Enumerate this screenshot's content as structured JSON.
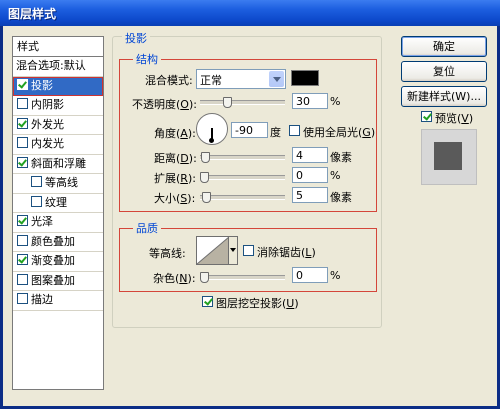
{
  "window": {
    "title": "图层样式"
  },
  "style_list": {
    "header": "样式",
    "blend_options": "混合选项:默认",
    "items": [
      {
        "label": "投影",
        "checked": true,
        "selected": true,
        "indent": false
      },
      {
        "label": "内阴影",
        "checked": false,
        "indent": false
      },
      {
        "label": "外发光",
        "checked": true,
        "indent": false
      },
      {
        "label": "内发光",
        "checked": false,
        "indent": false
      },
      {
        "label": "斜面和浮雕",
        "checked": true,
        "indent": false
      },
      {
        "label": "等高线",
        "checked": false,
        "indent": true
      },
      {
        "label": "纹理",
        "checked": false,
        "indent": true
      },
      {
        "label": "光泽",
        "checked": true,
        "indent": false
      },
      {
        "label": "颜色叠加",
        "checked": false,
        "indent": false
      },
      {
        "label": "渐变叠加",
        "checked": true,
        "indent": false
      },
      {
        "label": "图案叠加",
        "checked": false,
        "indent": false
      },
      {
        "label": "描边",
        "checked": false,
        "indent": false
      }
    ]
  },
  "drop_shadow": {
    "group_title": "投影",
    "structure": {
      "title": "结构",
      "blend_mode_label": "混合模式:",
      "blend_mode_value": "正常",
      "shadow_color": "#000000",
      "opacity_label_pre": "不透明度(",
      "opacity_key": "O",
      "opacity_label_post": "):",
      "opacity_value": "30",
      "opacity_unit": "%",
      "angle_label_pre": "角度(",
      "angle_key": "A",
      "angle_label_post": "):",
      "angle_value": "-90",
      "angle_unit": "度",
      "global_light_pre": "使用全局光(",
      "global_light_key": "G",
      "global_light_post": ")",
      "global_light_checked": false,
      "distance_label_pre": "距离(",
      "distance_key": "D",
      "distance_label_post": "):",
      "distance_value": "4",
      "distance_unit": "像素",
      "spread_label_pre": "扩展(",
      "spread_key": "R",
      "spread_label_post": "):",
      "spread_value": "0",
      "spread_unit": "%",
      "size_label_pre": "大小(",
      "size_key": "S",
      "size_label_post": "):",
      "size_value": "5",
      "size_unit": "像素"
    },
    "quality": {
      "title": "品质",
      "contour_label": "等高线:",
      "anti_alias_pre": "消除锯齿(",
      "anti_alias_key": "L",
      "anti_alias_post": ")",
      "anti_alias_checked": false,
      "noise_label_pre": "杂色(",
      "noise_key": "N",
      "noise_label_post": "):",
      "noise_value": "0",
      "noise_unit": "%"
    },
    "knockout_pre": "图层挖空投影(",
    "knockout_key": "U",
    "knockout_post": ")",
    "knockout_checked": true
  },
  "buttons": {
    "ok": "确定",
    "reset": "复位",
    "new_style": "新建样式(W)...",
    "preview_pre": "预览(",
    "preview_key": "V",
    "preview_post": ")",
    "preview_checked": true
  },
  "colors": {
    "accent": "#316ac5",
    "highlight_border": "#d4463a",
    "group_title": "#0046d5"
  }
}
